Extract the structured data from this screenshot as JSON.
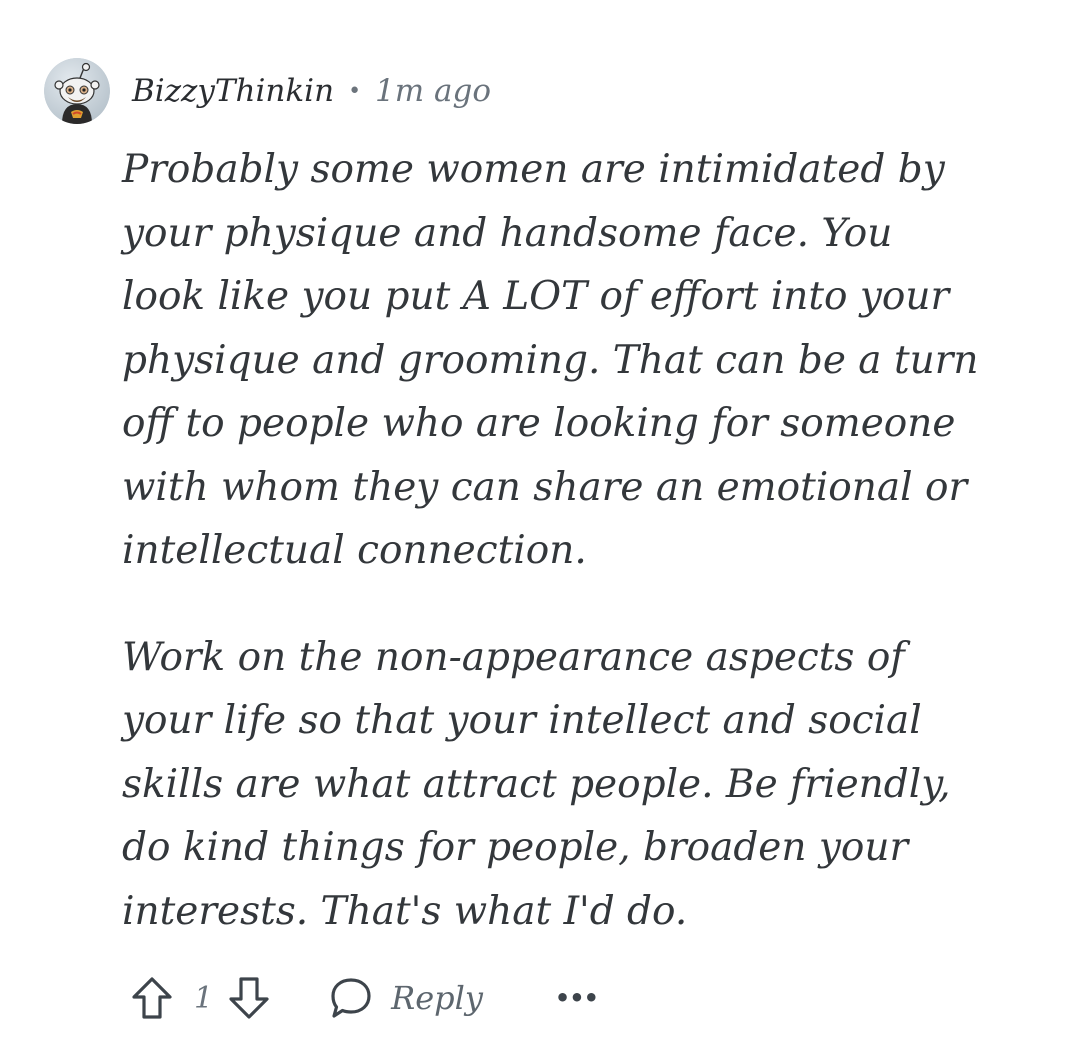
{
  "comment": {
    "author": "BizzyThinkin",
    "separator": "•",
    "timestamp": "1m ago",
    "avatar_icon": "snoo-avatar-icon",
    "paragraphs": [
      [
        "Probably some women are intimidated by",
        "your physique and handsome face. You",
        "look like you put A LOT of effort into your",
        "physique and grooming. That can be a turn",
        "off to people who are looking for someone",
        "with whom they can share an emotional or",
        "intellectual connection."
      ],
      [
        "Work on the non-appearance aspects of",
        "your life so that your intellect and social",
        "skills are what attract people. Be friendly,",
        "do kind things for people, broaden your",
        "interests. That's what I'd do."
      ]
    ]
  },
  "actions": {
    "upvote_icon": "arrow-up-icon",
    "vote_count": "1",
    "downvote_icon": "arrow-down-icon",
    "reply_icon": "speech-bubble-icon",
    "reply_label": "Reply",
    "more_icon": "ellipsis-icon",
    "more_label": "•••"
  },
  "colors": {
    "text": "#33373b",
    "muted": "#6a737c",
    "icon": "#3d444b",
    "background": "#ffffff"
  }
}
